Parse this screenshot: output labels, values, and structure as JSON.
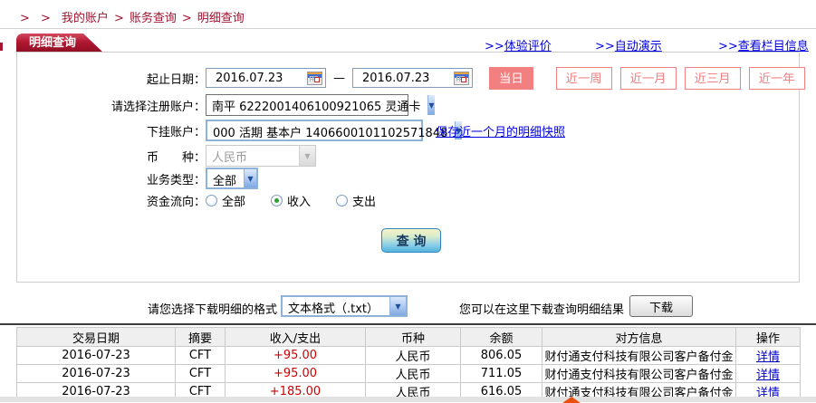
{
  "breadcrumb": {
    "prefix": "> >",
    "separator": ">",
    "items": [
      "我的账户",
      "账务查询",
      "明细查询"
    ]
  },
  "tab": {
    "label": "明细查询"
  },
  "top_links": [
    {
      "prefix": ">>",
      "label": "体验评价"
    },
    {
      "prefix": ">>",
      "label": "自动演示"
    },
    {
      "prefix": ">>",
      "label": "查看栏目信息"
    }
  ],
  "icons": {
    "dropdown_arrow": "▼",
    "calendar": "calendar-grid"
  },
  "form": {
    "date_label": "起止日期：",
    "date_from": "2016.07.23",
    "date_to": "2016.07.23",
    "date_separator": "—",
    "quick_buttons": [
      {
        "label": "当日",
        "active": true
      },
      {
        "label": "近一周",
        "active": false
      },
      {
        "label": "近一月",
        "active": false
      },
      {
        "label": "近三月",
        "active": false
      },
      {
        "label": "近一年",
        "active": false
      }
    ],
    "register_account_label": "请选择注册账户：",
    "register_account_value": "南平  6222001406100921065 灵通卡",
    "sub_account_label": "下挂账户：",
    "sub_account_value": "000 活期 基本户 1406600101102571848",
    "snapshot_link": "保存近一个月的明细快照",
    "currency_label": "币　　种：",
    "currency_value": "人民币",
    "biz_type_label": "业务类型：",
    "biz_type_value": "全部",
    "flow_label": "资金流向：",
    "flow_options": [
      {
        "label": "全部",
        "selected": false
      },
      {
        "label": "收入",
        "selected": true
      },
      {
        "label": "支出",
        "selected": false
      }
    ],
    "query_button": "查 询"
  },
  "download": {
    "format_label": "请您选择下载明细的格式",
    "format_value": "文本格式（.txt）",
    "hint": "您可以在这里下载查询明细结果",
    "button": "下载"
  },
  "table": {
    "headers": [
      "交易日期",
      "摘要",
      "收入/支出",
      "币种",
      "余额",
      "对方信息",
      "操作"
    ],
    "rows": [
      {
        "date": "2016-07-23",
        "summary": "CFT",
        "amount": "+95.00",
        "currency": "人民币",
        "balance": "806.05",
        "counterparty": "财付通支付科技有限公司客户备付金",
        "action": "详情"
      },
      {
        "date": "2016-07-23",
        "summary": "CFT",
        "amount": "+95.00",
        "currency": "人民币",
        "balance": "711.05",
        "counterparty": "财付通支付科技有限公司客户备付金",
        "action": "详情"
      },
      {
        "date": "2016-07-23",
        "summary": "CFT",
        "amount": "+185.00",
        "currency": "人民币",
        "balance": "616.05",
        "counterparty": "财付通支付科技有限公司客户备付金",
        "action": "详情"
      }
    ]
  },
  "colors": {
    "breadcrumb_red": "#a3122e",
    "tab_red": "#b01830",
    "link_blue": "#0000e0",
    "quick_btn_salmon": "#f28080",
    "amount_red": "#d00000",
    "query_btn_blue": "#52b4dd",
    "header_gray": "#efefef"
  }
}
